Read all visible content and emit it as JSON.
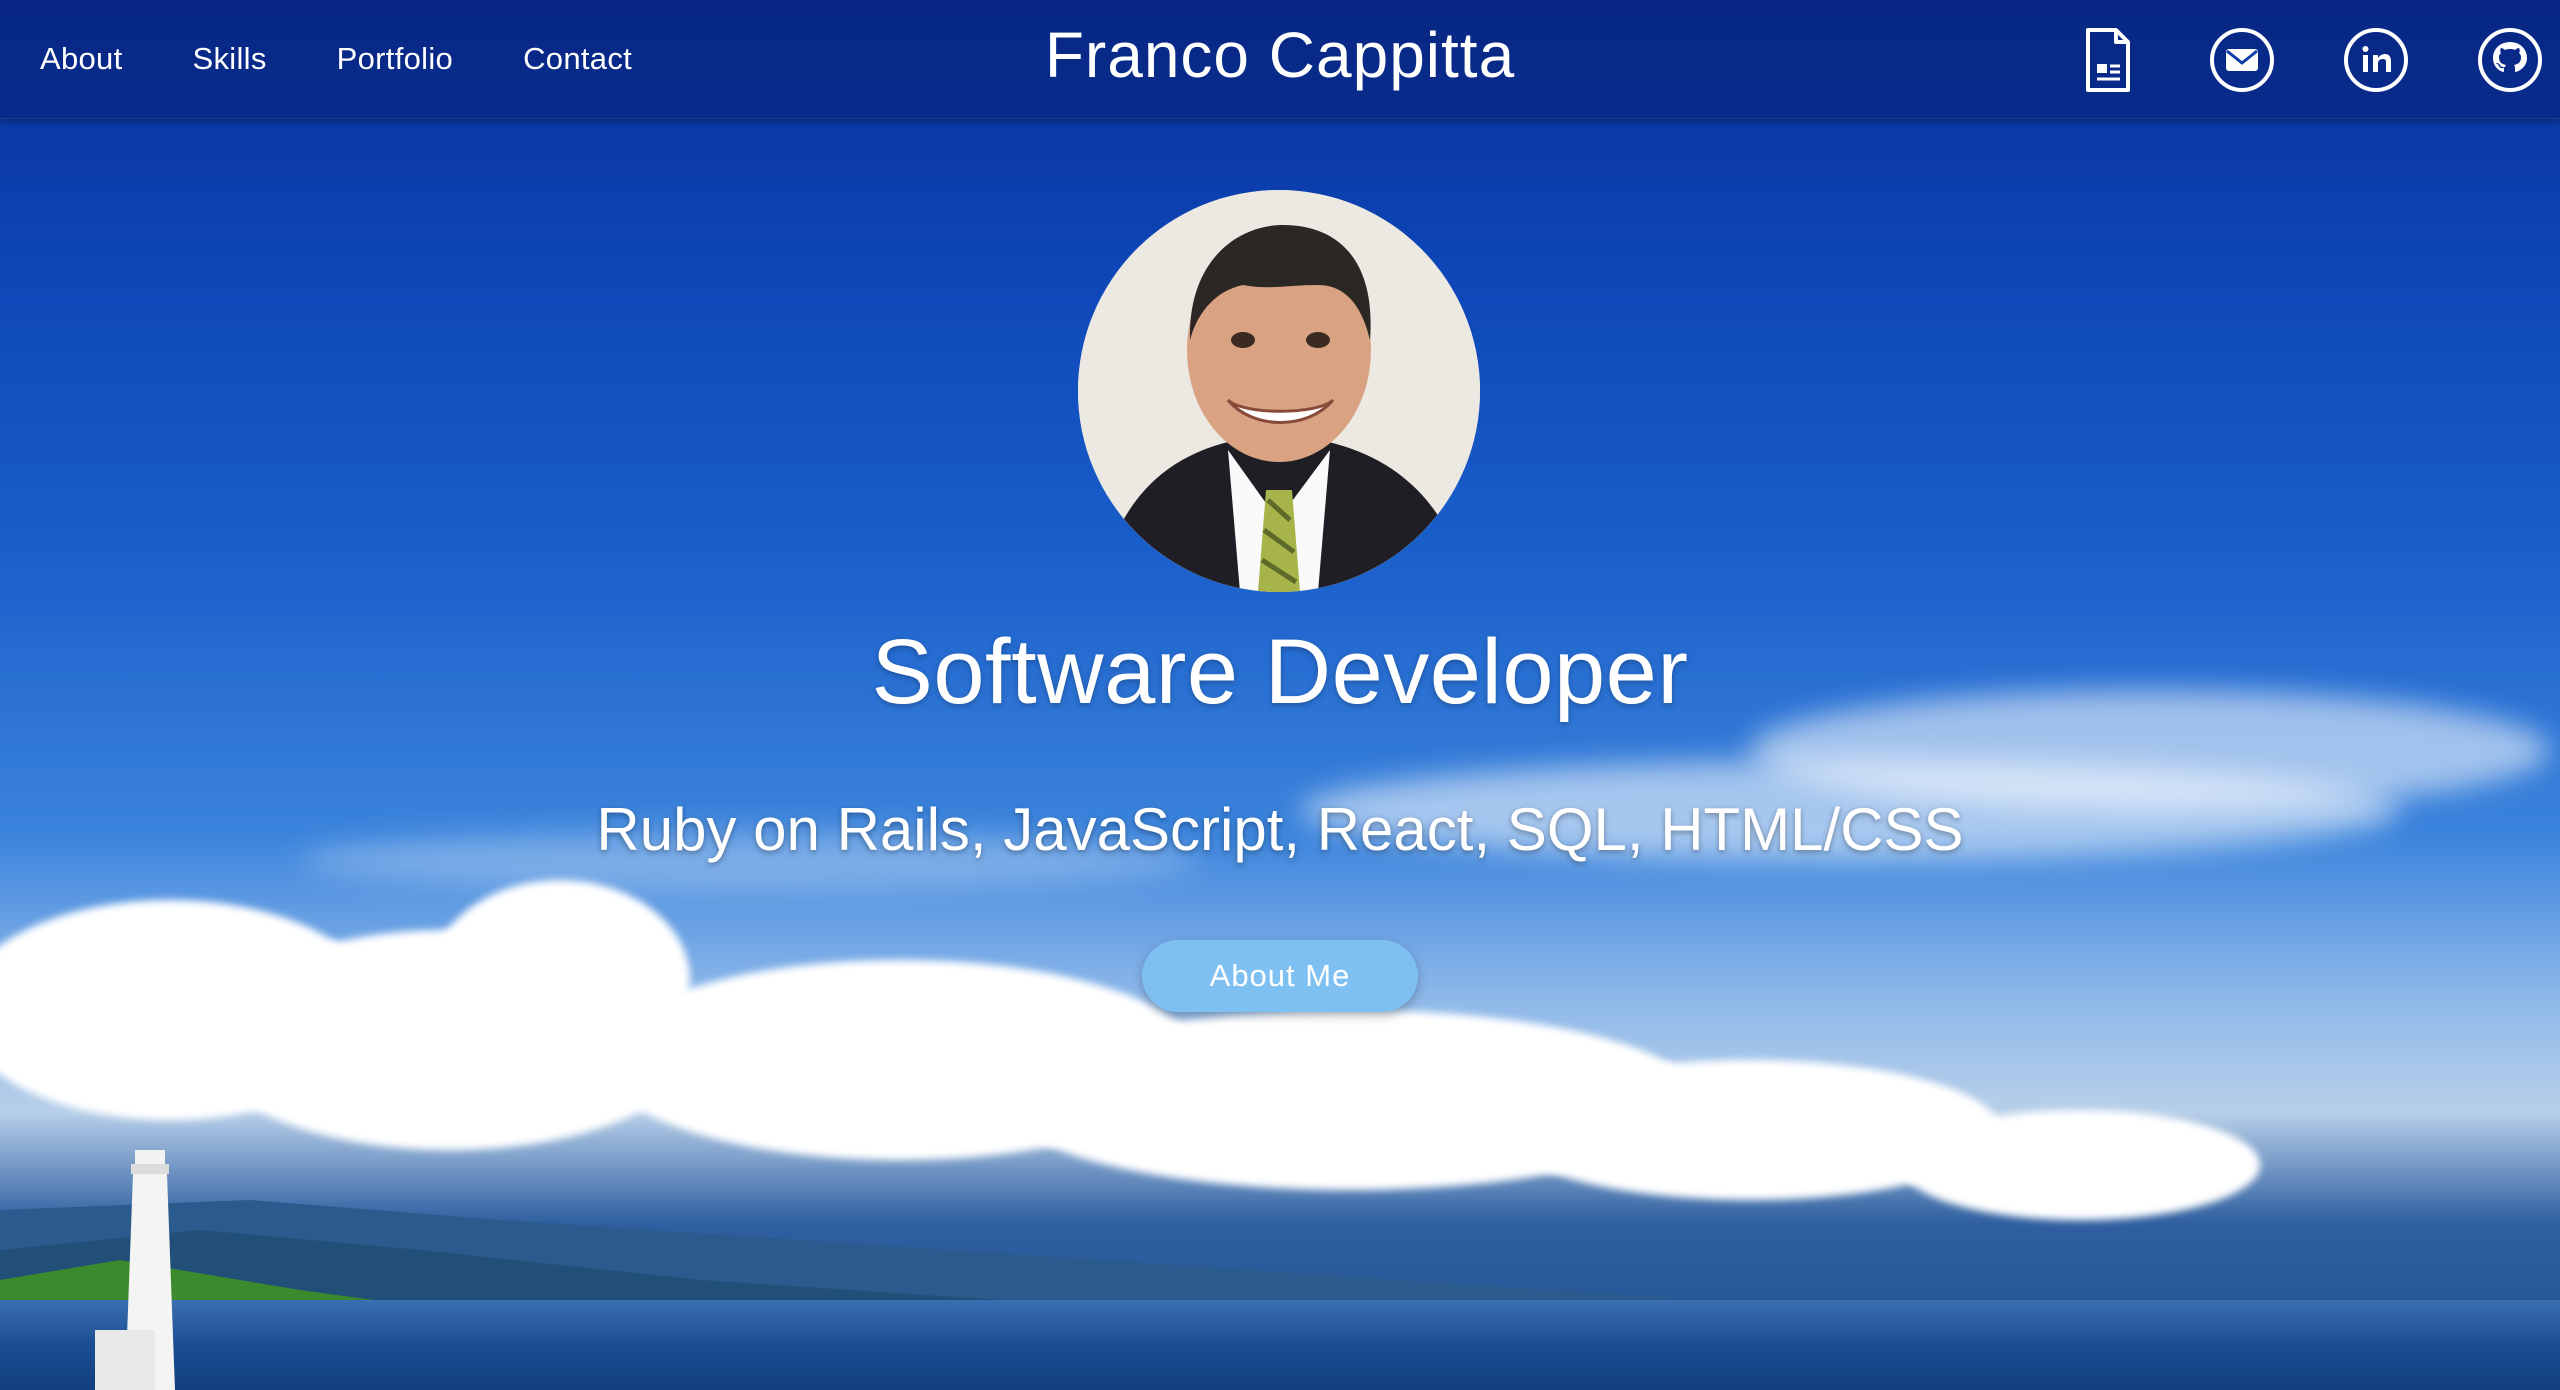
{
  "nav": {
    "links": [
      "About",
      "Skills",
      "Portfolio",
      "Contact"
    ],
    "brand": "Franco Cappitta",
    "icons": [
      "resume-icon",
      "email-icon",
      "linkedin-icon",
      "github-icon"
    ]
  },
  "hero": {
    "title": "Software Developer",
    "subtitle": "Ruby on Rails, JavaScript, React, SQL, HTML/CSS",
    "button_label": "About Me"
  },
  "colors": {
    "sky_top": "#0a2f93",
    "button": "#7ec0f2",
    "text": "#ffffff"
  }
}
